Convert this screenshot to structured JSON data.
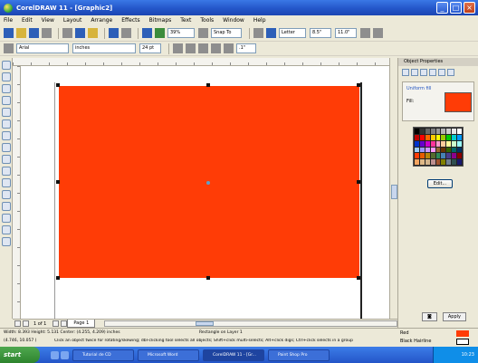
{
  "window": {
    "title": "CorelDRAW 11 - [Graphic2]"
  },
  "menu": [
    "File",
    "Edit",
    "View",
    "Layout",
    "Arrange",
    "Effects",
    "Bitmaps",
    "Text",
    "Tools",
    "Window",
    "Help"
  ],
  "toolbar": {
    "zoom": "39%",
    "snap": "Snap To",
    "paper": "Letter",
    "width": "8.5\"",
    "height": "11.0\"",
    "units": "inches",
    "nudge": ".1\"",
    "font_name": "Arial",
    "font_size": "24 pt"
  },
  "docker": {
    "title": "Object Properties",
    "fill_header": "Uniform fill",
    "fill_label": "Fill:",
    "fill_color": "#ff3c06",
    "edit_button": "Edit...",
    "apply_button": "Apply",
    "palette": [
      "#000000",
      "#333333",
      "#666666",
      "#808080",
      "#999999",
      "#b3b3b3",
      "#cccccc",
      "#e6e6e6",
      "#ffffff",
      "#c00000",
      "#ff0000",
      "#ff6600",
      "#ffcc00",
      "#ffff00",
      "#99cc00",
      "#00cc00",
      "#00cccc",
      "#0099ff",
      "#0033cc",
      "#6600cc",
      "#cc00cc",
      "#ff3399",
      "#ff99cc",
      "#ffcc99",
      "#ffff99",
      "#ccffcc",
      "#99ffff",
      "#99ccff",
      "#9999ff",
      "#cc99ff",
      "#ff99ff",
      "#996633",
      "#663300",
      "#336600",
      "#006666",
      "#003366",
      "#ff3c06",
      "#e65c00",
      "#b8860b",
      "#556b2f",
      "#2e8b57",
      "#4682b4",
      "#483d8b",
      "#8b008b",
      "#8b0000",
      "#f4a460",
      "#deb887",
      "#d2b48c",
      "#bc8f8f",
      "#a0522d",
      "#808000",
      "#708090",
      "#2f4f4f",
      "#191970"
    ]
  },
  "page_tabs": {
    "count": "1 of 1",
    "tab": "Page 1"
  },
  "status": {
    "line1": "Width: 8.393  Height: 5.131  Center: (4.255, 4.209)  inches",
    "object": "Rectangle on Layer 1",
    "line2": "(4.746, 10.057 )",
    "hint": "Click an object twice for rotating/skewing; dbl-clicking tool selects all objects; Shift+click multi-selects; Alt+click digs; Ctrl+click selects in a group",
    "fill_label": "Red",
    "fill_color": "#ff3c06",
    "outline_label": "Black  Hairline",
    "outline_color": "#000000"
  },
  "taskbar": {
    "start": "start",
    "tasks": [
      "Tutorial de CD",
      "Microsoft Word",
      "CorelDRAW 11 - [Gr...",
      "Paint Shop Pro"
    ],
    "active_index": 2,
    "clock": "10:23"
  }
}
